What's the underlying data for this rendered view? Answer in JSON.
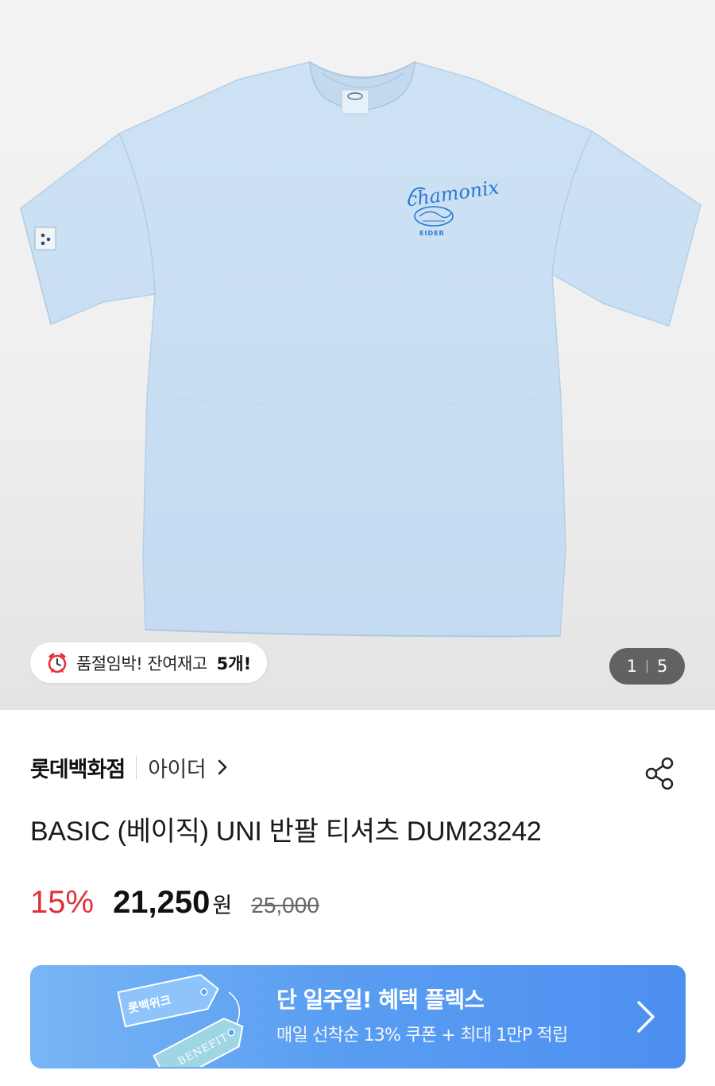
{
  "hero": {
    "stock_badge": {
      "icon": "alarm-clock-icon",
      "text": "품절임박! 잔여재고",
      "count": "5개!"
    },
    "pager": {
      "current": "1",
      "total": "5"
    },
    "print": {
      "script": "chamonix",
      "brand": "EIDER"
    }
  },
  "product": {
    "store": "롯데백화점",
    "brand": "아이더",
    "title": "BASIC (베이직) UNI 반팔 티셔츠 DUM23242"
  },
  "pricing": {
    "discount": "15%",
    "price": "21,250",
    "currency": "원",
    "original": "25,000"
  },
  "banner": {
    "ticket_top": "롯백위크",
    "ticket_bottom": "BENEFIT",
    "title": "단 일주일! 혜택 플렉스",
    "subtitle": "매일 선착순 13% 쿠폰 + 최대 1만P 적립"
  },
  "colors": {
    "accent_red": "#e0323a",
    "banner_blue": "#5a9ef2",
    "shirt": "#c7def2"
  }
}
